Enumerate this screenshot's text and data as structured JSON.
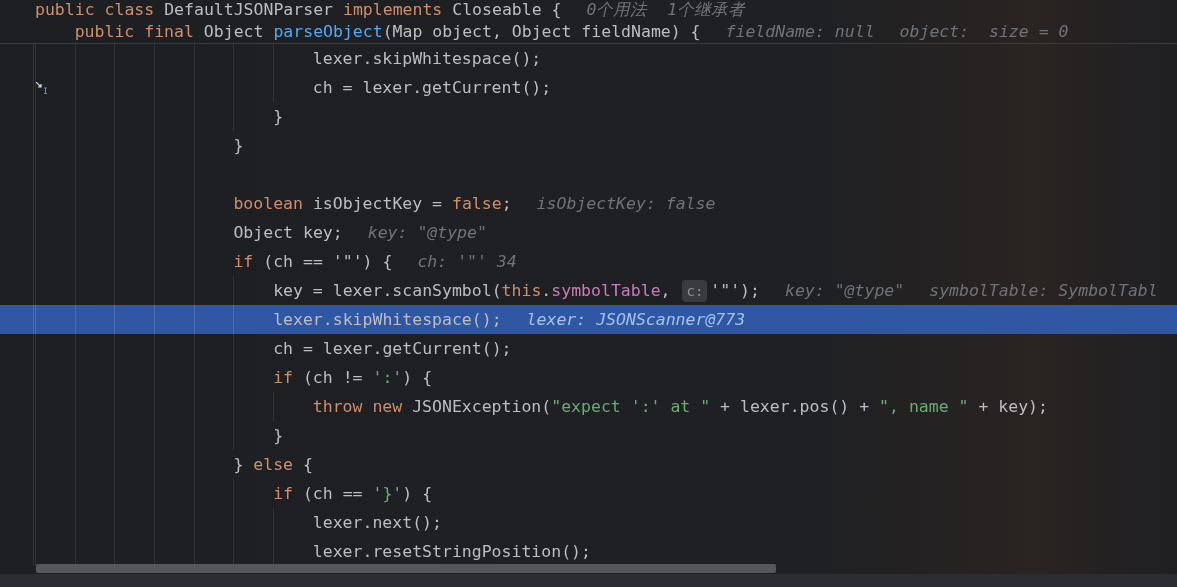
{
  "sticky_lines": [
    {
      "kind": "code",
      "code": [
        {
          "kind": "keyword",
          "text": "public class"
        },
        {
          "kind": "plain",
          "text": " DefaultJSONParser "
        },
        {
          "kind": "keyword",
          "text": "implements"
        },
        {
          "kind": "plain",
          "text": " Closeable {"
        }
      ],
      "hints": [
        "0个用法  1个继承者"
      ],
      "children": [
        {
          "kind": "code",
          "code": [
            {
              "kind": "keyword",
              "text": "public final"
            },
            {
              "kind": "plain",
              "text": " Object "
            },
            {
              "kind": "method",
              "text": "parseObject"
            },
            {
              "kind": "plain",
              "text": "(Map object, Object fieldName) {"
            }
          ],
          "hints": [
            "fieldName: null",
            "object:  size = 0"
          ]
        }
      ]
    }
  ],
  "lines": [
    {
      "kind": "group",
      "children": [
        {
          "kind": "group",
          "children": [
            {
              "kind": "code",
              "current": false,
              "code": [
                {
                  "kind": "plain",
                  "text": "lexer.skipWhitespace();"
                }
              ]
            },
            {
              "kind": "code",
              "current": false,
              "code": [
                {
                  "kind": "plain",
                  "text": "ch = lexer.getCurrent();"
                }
              ]
            }
          ]
        },
        {
          "kind": "code",
          "current": false,
          "code": [
            {
              "kind": "plain",
              "text": "}"
            }
          ]
        }
      ]
    },
    {
      "kind": "code",
      "current": false,
      "code": [
        {
          "kind": "plain",
          "text": "}"
        }
      ]
    },
    {
      "kind": "blank"
    },
    {
      "kind": "code",
      "current": false,
      "code": [
        {
          "kind": "keyword",
          "text": "boolean"
        },
        {
          "kind": "plain",
          "text": " isObjectKey = "
        },
        {
          "kind": "keyword",
          "text": "false"
        },
        {
          "kind": "plain",
          "text": ";"
        }
      ],
      "hints": [
        "isObjectKey: false"
      ]
    },
    {
      "kind": "code",
      "current": false,
      "code": [
        {
          "kind": "plain",
          "text": "Object key;"
        }
      ],
      "hints": [
        "key: \"@type\""
      ]
    },
    {
      "kind": "code",
      "current": false,
      "code": [
        {
          "kind": "keyword",
          "text": "if"
        },
        {
          "kind": "plain",
          "text": " (ch == '\"') {"
        }
      ],
      "hints": [
        "ch: '\"' 34"
      ],
      "children": [
        {
          "kind": "code",
          "current": false,
          "code": [
            {
              "kind": "plain",
              "text": "key = lexer.scanSymbol("
            },
            {
              "kind": "keyword",
              "text": "this"
            },
            {
              "kind": "plain",
              "text": "."
            },
            {
              "kind": "field",
              "text": "symbolTable"
            },
            {
              "kind": "plain",
              "text": ", "
            },
            {
              "kind": "inlay",
              "text": "c:"
            },
            {
              "kind": "plain",
              "text": "'\"');"
            }
          ],
          "hints": [
            "key: \"@type\"",
            "symbolTable: SymbolTabl"
          ]
        },
        {
          "kind": "code",
          "current": true,
          "code": [
            {
              "kind": "plain",
              "text": "lexer.skipWhitespace();"
            }
          ],
          "hints": [
            "lexer: JSONScanner@773"
          ]
        },
        {
          "kind": "code",
          "current": false,
          "code": [
            {
              "kind": "plain",
              "text": "ch = lexer.getCurrent();"
            }
          ]
        },
        {
          "kind": "code",
          "current": false,
          "code": [
            {
              "kind": "keyword",
              "text": "if"
            },
            {
              "kind": "plain",
              "text": " (ch != "
            },
            {
              "kind": "string",
              "text": "':'"
            },
            {
              "kind": "plain",
              "text": ") {"
            }
          ],
          "children": [
            {
              "kind": "code",
              "current": false,
              "code": [
                {
                  "kind": "keyword",
                  "text": "throw new"
                },
                {
                  "kind": "plain",
                  "text": " JSONException("
                },
                {
                  "kind": "string",
                  "text": "\"expect ':' at \""
                },
                {
                  "kind": "plain",
                  "text": " + lexer.pos() + "
                },
                {
                  "kind": "string",
                  "text": "\", name \""
                },
                {
                  "kind": "plain",
                  "text": " + key);"
                }
              ]
            }
          ]
        },
        {
          "kind": "code",
          "current": false,
          "code": [
            {
              "kind": "plain",
              "text": "}"
            }
          ]
        }
      ]
    },
    {
      "kind": "code",
      "current": false,
      "code": [
        {
          "kind": "plain",
          "text": "} "
        },
        {
          "kind": "keyword",
          "text": "else"
        },
        {
          "kind": "plain",
          "text": " {"
        }
      ],
      "children": [
        {
          "kind": "code",
          "current": false,
          "code": [
            {
              "kind": "keyword",
              "text": "if"
            },
            {
              "kind": "plain",
              "text": " (ch == "
            },
            {
              "kind": "string",
              "text": "'}'"
            },
            {
              "kind": "plain",
              "text": ") {"
            }
          ],
          "children": [
            {
              "kind": "code",
              "current": false,
              "code": [
                {
                  "kind": "plain",
                  "text": "lexer.next();"
                }
              ]
            },
            {
              "kind": "code",
              "current": false,
              "code": [
                {
                  "kind": "plain",
                  "text": "lexer.resetStringPosition();"
                }
              ]
            }
          ]
        }
      ]
    }
  ]
}
